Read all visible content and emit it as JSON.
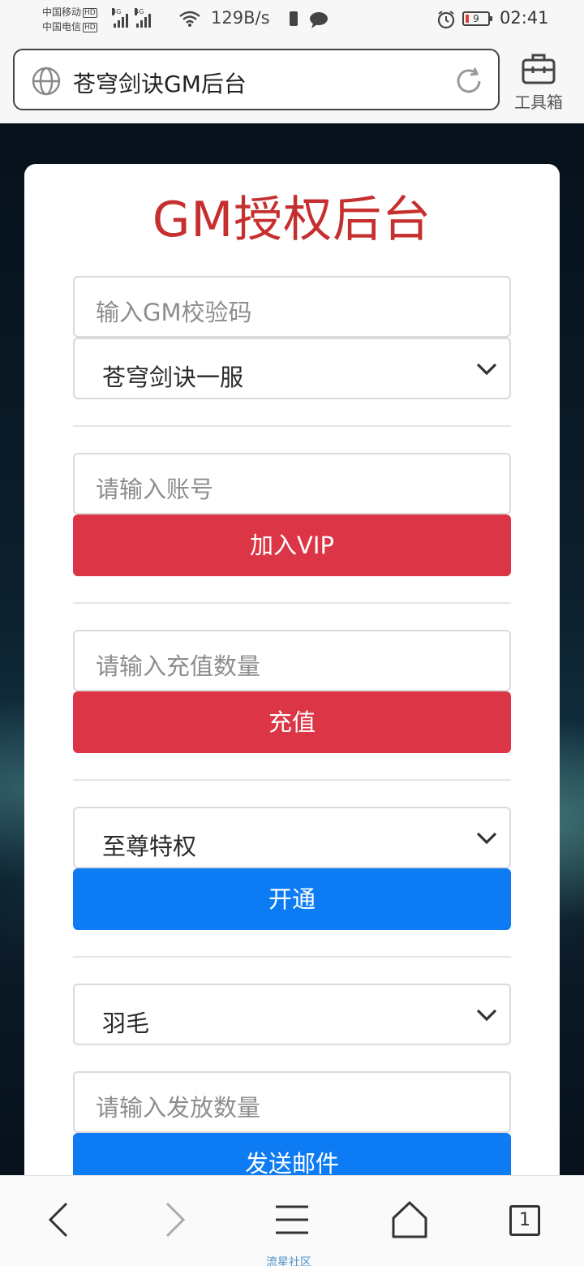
{
  "status_bar": {
    "carrier_1": "中国移动",
    "carrier_2": "中国电信",
    "hd_badge": "HD",
    "net_type": "4G",
    "net_speed": "129B/s",
    "battery_level": "9",
    "time": "02:41"
  },
  "browser": {
    "url_title": "苍穹剑诀GM后台",
    "toolbox_label": "工具箱"
  },
  "panel": {
    "title": "GM授权后台",
    "gm_code_placeholder": "输入GM校验码",
    "server_select_value": "苍穹剑诀一服",
    "account_placeholder": "请输入账号",
    "vip_button": "加入VIP",
    "recharge_placeholder": "请输入充值数量",
    "recharge_button": "充值",
    "privilege_select_value": "至尊特权",
    "activate_button": "开通",
    "item_select_value": "羽毛",
    "send_amount_placeholder": "请输入发放数量",
    "send_mail_button": "发送邮件"
  },
  "bottom_nav": {
    "icons": [
      "back-icon",
      "forward-icon",
      "menu-icon",
      "home-icon",
      "tabs-icon"
    ],
    "tab_count": "1",
    "watermark": "流星社区"
  },
  "colors": {
    "title_red": "#c62f2f",
    "danger_button": "#dc3545",
    "primary_button": "#0d7bf4"
  }
}
